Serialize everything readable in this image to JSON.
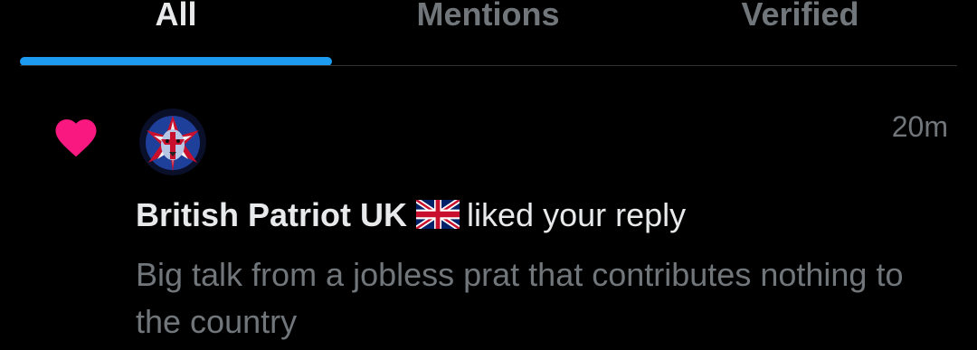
{
  "tabs": [
    {
      "label": "All",
      "active": true
    },
    {
      "label": "Mentions",
      "active": false
    },
    {
      "label": "Verified",
      "active": false
    }
  ],
  "notification": {
    "icon": "heart-icon",
    "avatar_icon": "union-jack-lion-avatar",
    "timestamp": "20m",
    "user_name": "British Patriot UK",
    "flag_icon": "uk-flag-icon",
    "action": "liked your reply",
    "excerpt": "Big talk from a jobless prat that contributes nothing to the country"
  },
  "colors": {
    "background": "#000000",
    "accent": "#1d9bf0",
    "heart": "#f91880",
    "primary_text": "#e7e9ea",
    "secondary_text": "#71767b"
  }
}
